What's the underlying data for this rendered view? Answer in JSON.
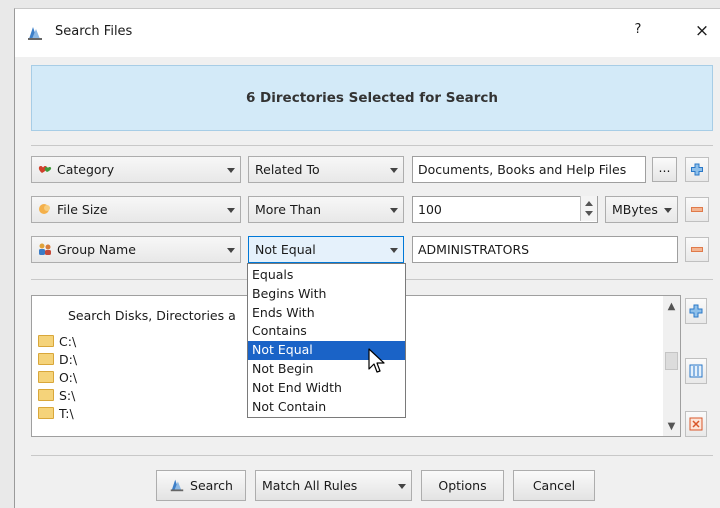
{
  "window": {
    "title": "Search Files",
    "help": "?",
    "close": "×"
  },
  "banner": {
    "text": "6 Directories Selected for Search"
  },
  "rules": [
    {
      "field": "Category",
      "operator": "Related To",
      "value": "Documents, Books and Help Files",
      "browse": "..."
    },
    {
      "field": "File Size",
      "operator": "More Than",
      "value": "100",
      "unit": "MBytes"
    },
    {
      "field": "Group Name",
      "operator": "Not Equal",
      "value": "ADMINISTRATORS"
    }
  ],
  "operator_dropdown": {
    "options": [
      "Equals",
      "Begins With",
      "Ends With",
      "Contains",
      "Not Equal",
      "Not Begin",
      "Not End Width",
      "Not Contain"
    ],
    "selected_index": 4
  },
  "directories": {
    "header": "Search Disks, Directories a",
    "items": [
      "C:\\",
      "D:\\",
      "O:\\",
      "S:\\",
      "T:\\"
    ]
  },
  "footer": {
    "search": "Search",
    "match_mode": "Match All Rules",
    "options": "Options",
    "cancel": "Cancel"
  },
  "icons": {
    "window": "search-files-icon",
    "category": "category-hearts-icon",
    "file_size": "file-size-icon",
    "group": "group-users-icon"
  },
  "colors": {
    "banner_bg": "#d3eaf8",
    "selection": "#1a63c7",
    "add": "#2a78c8",
    "remove": "#e07a4a"
  }
}
